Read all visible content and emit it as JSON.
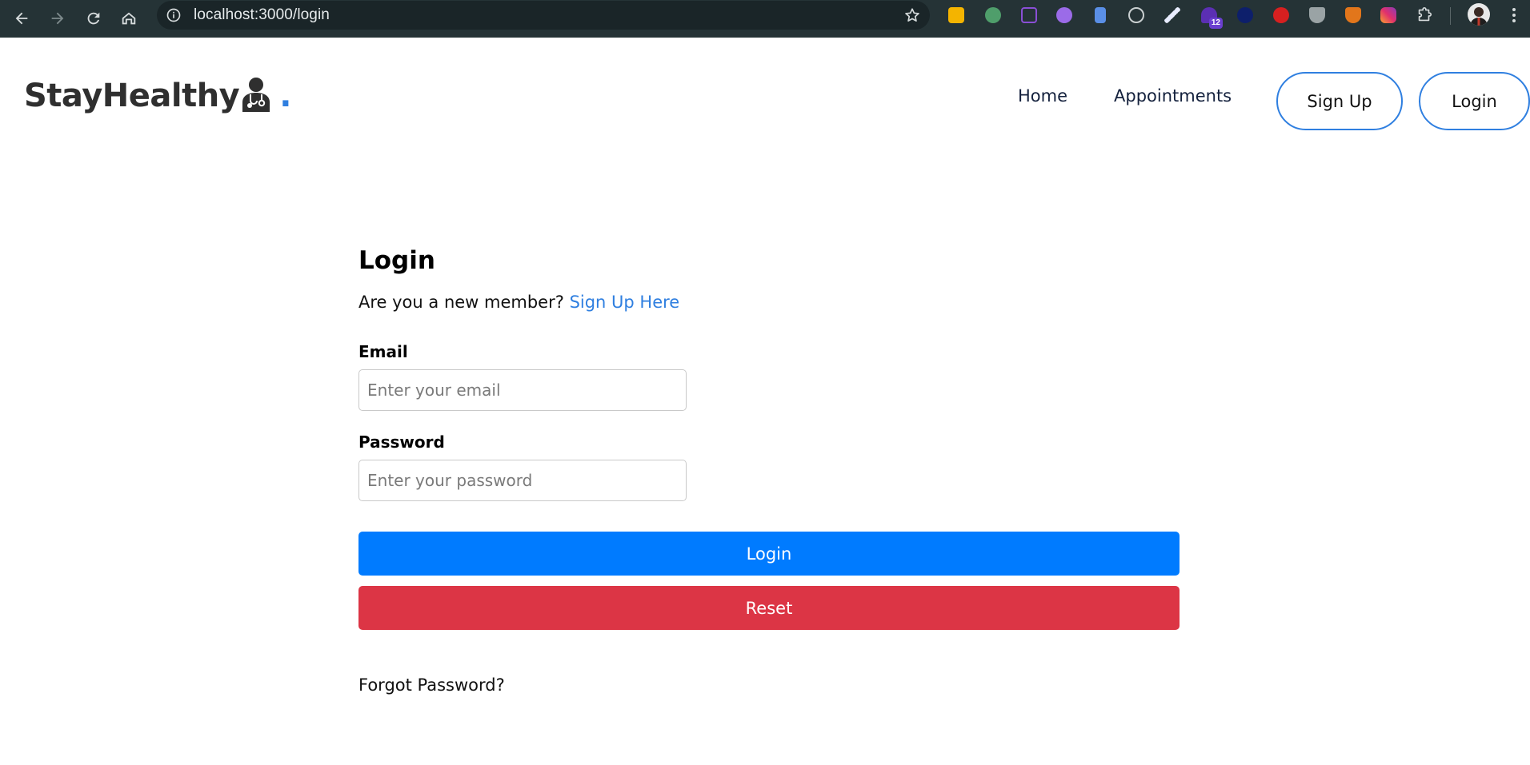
{
  "browser": {
    "url": "localhost:3000/login",
    "extension_badge": "12",
    "icons": {
      "back": "arrow-left-icon",
      "forward": "arrow-right-icon",
      "reload": "reload-icon",
      "home": "home-icon",
      "site_info": "info-icon",
      "bookmark": "star-icon",
      "extensions": "puzzle-icon",
      "menu": "more-vert-icon"
    }
  },
  "header": {
    "logo_text": "StayHealthy",
    "logo_dot": ".",
    "nav": {
      "home": "Home",
      "appointments": "Appointments"
    },
    "buttons": {
      "signup": "Sign Up",
      "login": "Login"
    }
  },
  "form": {
    "title": "Login",
    "member_prompt": "Are you a new member? ",
    "signup_link": "Sign Up Here",
    "email_label": "Email",
    "email_placeholder": "Enter your email",
    "password_label": "Password",
    "password_placeholder": "Enter your password",
    "login_button": "Login",
    "reset_button": "Reset",
    "forgot_password": "Forgot Password?"
  },
  "colors": {
    "accent": "#2f7fe0",
    "primary_button": "#007bff",
    "danger_button": "#dc3545",
    "chrome_bg": "#253336"
  }
}
